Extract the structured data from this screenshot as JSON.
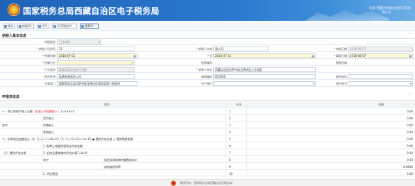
{
  "header": {
    "title": "国家税务总局西藏自治区电子税务局",
    "right_line1": "欢迎 西藏无線电力系统工程有",
    "right_line2": "限公司"
  },
  "toolbar": {
    "buttons": [
      "保存",
      "申报(S)",
      "打印",
      "打印预览(V)",
      "重置(R)"
    ]
  },
  "taxpayer": {
    "section_title": "纳税人基本信息",
    "row1": {
      "l1": "申报类型",
      "v1": "正常申报"
    },
    "row2": {
      "l1": "纳税人识别号",
      "v1": "                  15",
      "l2": "纳税人名称",
      "v2": "          限公司",
      "l3": "申报日期",
      "v3": "2018-08-07"
    },
    "row3": {
      "l1": "所属时期",
      "v1": "2018-07-01",
      "l2": "至",
      "v2": "2018-07-31",
      "l3": "填表日期",
      "v3": "2018-08-07"
    },
    "row4": {
      "l1": "所属行业",
      "v1": "",
      "l2": "税源编号",
      "v2": "",
      "l3": "税款所属",
      "v3": ""
    },
    "row5": {
      "l1": "行业类别",
      "v1": "陆路运输总部电子设备",
      "l2": "纳税人地址",
      "v2": "西藏自治区拉萨市堆龙德庆区工业园区"
    },
    "row6": {
      "l1": "经济性质",
      "v1": "私营有限责任公司",
      "l2": "邮政编码",
      "v2": "850000",
      "l3": "联系电话",
      "v3": ""
    },
    "row7": {
      "l1": "主管部门",
      "v1": "国家税务总局拉萨市堆龙德庆区税务局第一税务所",
      "l2": "开户银行",
      "v2": "",
      "l3": "银行账号",
      "v3": ""
    }
  },
  "declaration": {
    "section_title": "申报表信息",
    "col_item": "项目",
    "col_line": "行次",
    "col_amount": "金额",
    "rows": [
      {
        "group": "",
        "item": "一、转让房地产收入总额（",
        "item_hl": "应该入不含税收入",
        "item_tail": "）1=2+3+4",
        "line": "1",
        "amount": "0.00"
      },
      {
        "group": "",
        "item": "货币收入",
        "line": "2",
        "amount": "0.00"
      },
      {
        "group": "其中",
        "item": "实物收入",
        "line": "3",
        "amount": "0.00"
      },
      {
        "group": "",
        "item": "其他收入",
        "line": "4",
        "amount": "0.00"
      },
      {
        "group": "",
        "item": "二、扣除项目金额合计（1）5=6+7+10+15（2）5=11+12+14+15  ● 提供评估价格  ○ 提供购房发票",
        "line": "5",
        "amount": "0.00"
      },
      {
        "group": "",
        "item": "1. 取得土地使用权所支付的金额",
        "line": "6",
        "amount": "0.00"
      },
      {
        "group": "（1）提供评估价格",
        "item": "2. 旧房及建筑物的评估价格7=8×9",
        "line": "7",
        "amount": "0.00"
      },
      {
        "group": "",
        "item": "其中",
        "sub": "旧房及建筑物的重置成本价",
        "line": "8",
        "amount": "0.00"
      },
      {
        "group": "",
        "item": "",
        "sub": "成新度折扣率",
        "line": "9",
        "amount": "0.0000"
      },
      {
        "group": "",
        "item": "3. 评估费用",
        "line": "10",
        "amount": "0.00"
      }
    ]
  },
  "footer": {
    "text": "版权所有：国家税务总局西藏自治区税务局"
  }
}
